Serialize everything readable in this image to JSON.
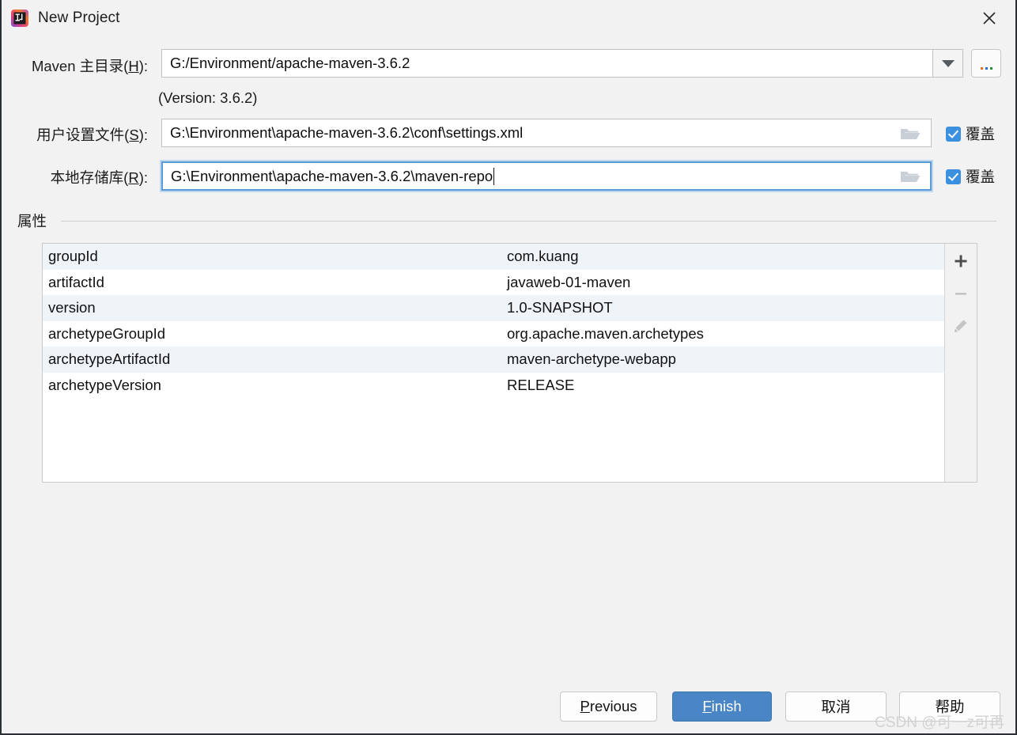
{
  "window": {
    "title": "New Project",
    "icon": "intellij-idea-icon",
    "close_icon": "close-icon"
  },
  "form": {
    "maven_home": {
      "label_prefix": "Maven ",
      "label_cn": "主目录",
      "mnemonic": "H",
      "label_suffix": ":",
      "value": "G:/Environment/apache-maven-3.6.2",
      "dropdown_icon": "chevron-down-icon",
      "browse_label": "...",
      "version_note": "(Version: 3.6.2)"
    },
    "settings_file": {
      "label_cn": "用户设置文件",
      "mnemonic": "S",
      "label_suffix": ":",
      "value": "G:\\Environment\\apache-maven-3.6.2\\conf\\settings.xml",
      "folder_icon": "folder-open-icon",
      "override_label": "覆盖",
      "override_checked": true
    },
    "local_repo": {
      "label_cn": "本地存储库",
      "mnemonic": "R",
      "label_suffix": ":",
      "value": "G:\\Environment\\apache-maven-3.6.2\\maven-repo",
      "folder_icon": "folder-open-icon",
      "override_label": "覆盖",
      "override_checked": true,
      "focused": true
    }
  },
  "properties": {
    "group_title": "属性",
    "rows": [
      {
        "key": "groupId",
        "value": "com.kuang"
      },
      {
        "key": "artifactId",
        "value": "javaweb-01-maven"
      },
      {
        "key": "version",
        "value": "1.0-SNAPSHOT"
      },
      {
        "key": "archetypeGroupId",
        "value": "org.apache.maven.archetypes"
      },
      {
        "key": "archetypeArtifactId",
        "value": "maven-archetype-webapp"
      },
      {
        "key": "archetypeVersion",
        "value": "RELEASE"
      }
    ],
    "toolbar": {
      "add_icon": "plus-icon",
      "remove_icon": "minus-icon",
      "edit_icon": "pencil-icon"
    }
  },
  "footer": {
    "previous": {
      "text_before": "",
      "mnemonic": "P",
      "text_after": "revious"
    },
    "finish": {
      "text_before": "",
      "mnemonic": "F",
      "text_after": "inish"
    },
    "cancel": "取消",
    "help": "帮助"
  },
  "watermark": "CSDN @可一z可再",
  "colors": {
    "dialog_bg": "#f2f2f2",
    "accent_blue": "#4a86c5",
    "checkbox_blue": "#3c90e0",
    "focus_border": "#5b9bd5",
    "row_alt": "#eff4f9"
  }
}
